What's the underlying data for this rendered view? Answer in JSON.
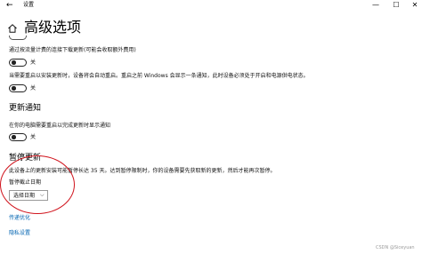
{
  "titlebar": {
    "back_glyph": "←",
    "title": "设置",
    "minimize_glyph": "—",
    "maximize_glyph": "☐",
    "close_glyph": "✕"
  },
  "page": {
    "title": "高级选项"
  },
  "settings": {
    "metered_text": "通过按流量计费的连接下载更新(可能会收取额外费用)",
    "metered_toggle": {
      "state_label": "关",
      "on": false
    },
    "restart_text": "当需要重启以安装更新时，设备将会自动重启。重启之前 Windows 会显示一条通知，此时设备必须处于开启和电源供电状态。",
    "restart_toggle": {
      "state_label": "关",
      "on": false
    }
  },
  "update_notifications": {
    "heading": "更新通知",
    "desc": "在你的电脑需要重启以完成更新时显示通知",
    "toggle": {
      "state_label": "关",
      "on": false
    }
  },
  "pause_updates": {
    "heading": "暂停更新",
    "desc": "此设备上的更新安装可能暂停长达 35 天。达到暂停限制时，你的设备需要先获取新的更新，然后才能再次暂停。",
    "pause_until_label": "暂停截止日期",
    "select": {
      "value": "选择日期",
      "chevron": "⌵"
    }
  },
  "links": {
    "delivery_optimization": "传递优化",
    "privacy_settings": "隐私设置"
  },
  "watermark": "CSDN @Siceyuan",
  "icons": {
    "back": "back-arrow-icon",
    "home": "home-icon",
    "chevron": "chevron-down-icon"
  },
  "colors": {
    "link": "#0063b1",
    "annotation": "#d0121b"
  }
}
